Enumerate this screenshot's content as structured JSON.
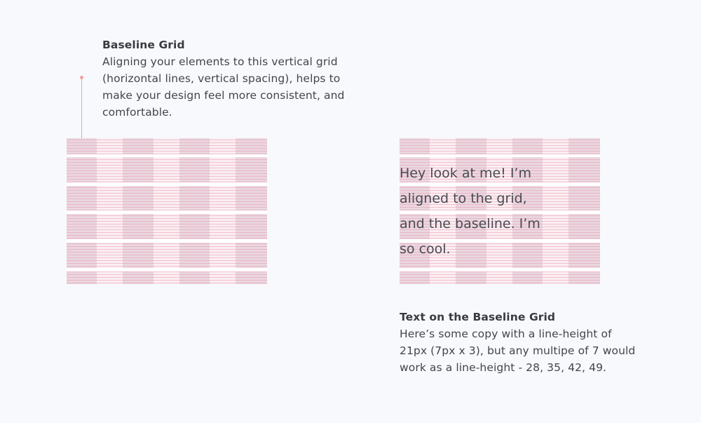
{
  "annotation_left": {
    "title": "Baseline Grid",
    "body_lines": [
      "Aligning your elements to this vertical grid",
      "(horizontal lines, vertical spacing), helps to",
      "make your design feel more consistent, and",
      "comfortable."
    ]
  },
  "aligned_text_lines": [
    "Hey look at me! I’m",
    "aligned to the grid,",
    "and the baseline. I’m",
    "so cool."
  ],
  "annotation_right": {
    "title": "Text on the Baseline Grid",
    "body_lines": [
      "Here’s some copy with a line-height of",
      "21px (7px x 3), but any multipe of 7 would",
      "work as a line-height - 28, 35, 42, 49."
    ]
  },
  "colors": {
    "background": "#f8f9fd",
    "column_fill": "#ead6df",
    "gutter_fill": "#fbeef2",
    "baseline_line": "#e59db0",
    "pointer": "#f2a0a0"
  }
}
